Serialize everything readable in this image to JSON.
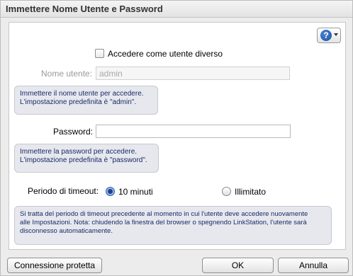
{
  "dialog": {
    "title": "Immettere Nome Utente e Password",
    "help_glyph": "?",
    "help_icon": "help-icon",
    "alt_user_label": "Accedere come utente diverso",
    "alt_user_checked": false,
    "username_label": "Nome utente:",
    "username_value": "admin",
    "username_hint": [
      "Immettere il nome utente per accedere.",
      "L'impostazione predefinita è \"admin\"."
    ],
    "password_label": "Password:",
    "password_value": "",
    "password_hint": [
      "Immettere la password per accedere.",
      "L'impostazione predefinita è \"password\"."
    ],
    "timeout_label": "Periodo di timeout:",
    "timeout_options": [
      "10 minuti",
      "Illimitato"
    ],
    "timeout_selected": "10 minuti",
    "timeout_hint": [
      "Si tratta del periodo di timeout precedente al momento in cui l'utente deve accedere nuovamente",
      "alle Impostazioni. Nota: chiudendo la finestra del browser o spegnendo LinkStation, l'utente sarà",
      "disconnesso automaticamente."
    ]
  },
  "footer": {
    "secure_button": "Connessione protetta",
    "ok_button": "OK",
    "cancel_button": "Annulla"
  }
}
